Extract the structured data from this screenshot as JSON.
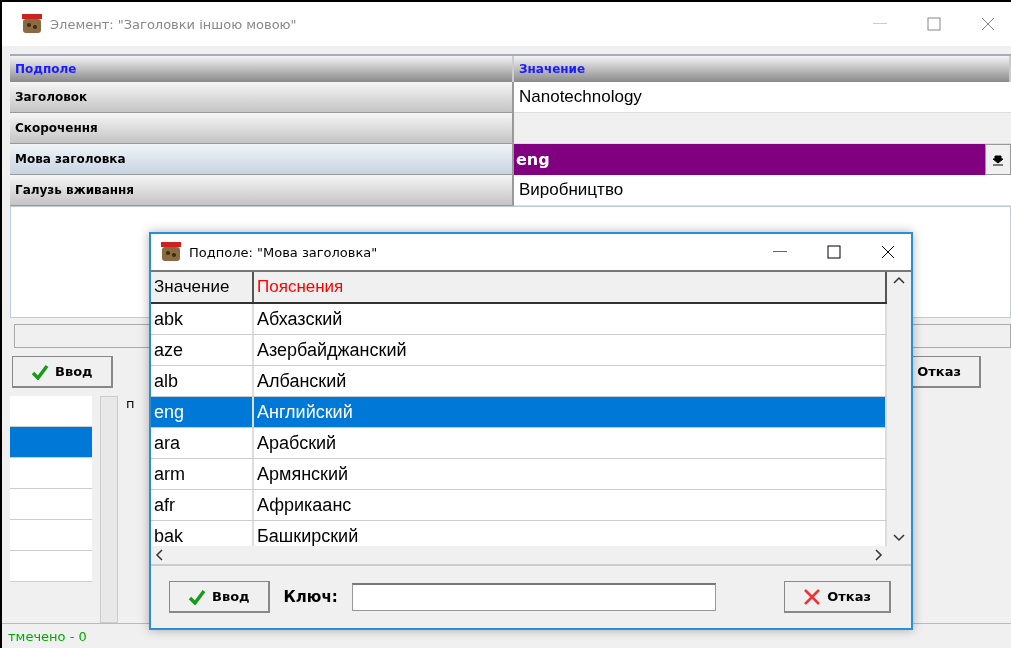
{
  "window": {
    "title": "Элемент: \"Заголовки  іншою мовою\""
  },
  "grid": {
    "columns": [
      "Подполе",
      "Значение"
    ],
    "rows": [
      {
        "field": "Заголовок",
        "value": "Nanotechnology",
        "selected": false,
        "kind": "text"
      },
      {
        "field": "Скорочення",
        "value": "",
        "selected": false,
        "kind": "text"
      },
      {
        "field": "Мова заголовка",
        "value": "eng",
        "selected": true,
        "kind": "dropdown"
      },
      {
        "field": "Галузь вживання",
        "value": "Виробництво",
        "selected": false,
        "kind": "text"
      }
    ]
  },
  "buttons": {
    "ok": "Ввод",
    "cancel": "Отказ"
  },
  "lower_panel": {
    "label": "п",
    "list": [
      {
        "selected": false
      },
      {
        "selected": true
      },
      {
        "selected": false
      },
      {
        "selected": false
      },
      {
        "selected": false
      },
      {
        "selected": false
      }
    ]
  },
  "status_bar": "тмечено - 0",
  "dialog": {
    "title": "Подполе: \"Мова заголовка\"",
    "columns": [
      "Значение",
      "Пояснения"
    ],
    "rows": [
      {
        "code": "abk",
        "name": "Абхазский",
        "selected": false
      },
      {
        "code": "aze",
        "name": "Азербайджанский",
        "selected": false
      },
      {
        "code": "alb",
        "name": "Албанский",
        "selected": false
      },
      {
        "code": "eng",
        "name": "Английский",
        "selected": true
      },
      {
        "code": "ara",
        "name": "Арабский",
        "selected": false
      },
      {
        "code": "arm",
        "name": "Армянский",
        "selected": false
      },
      {
        "code": "afr",
        "name": "Африкаанс",
        "selected": false
      },
      {
        "code": "bak",
        "name": "Башкирский",
        "selected": false
      }
    ],
    "ok": "Ввод",
    "key_label": "Ключ:",
    "cancel": "Отказ"
  }
}
